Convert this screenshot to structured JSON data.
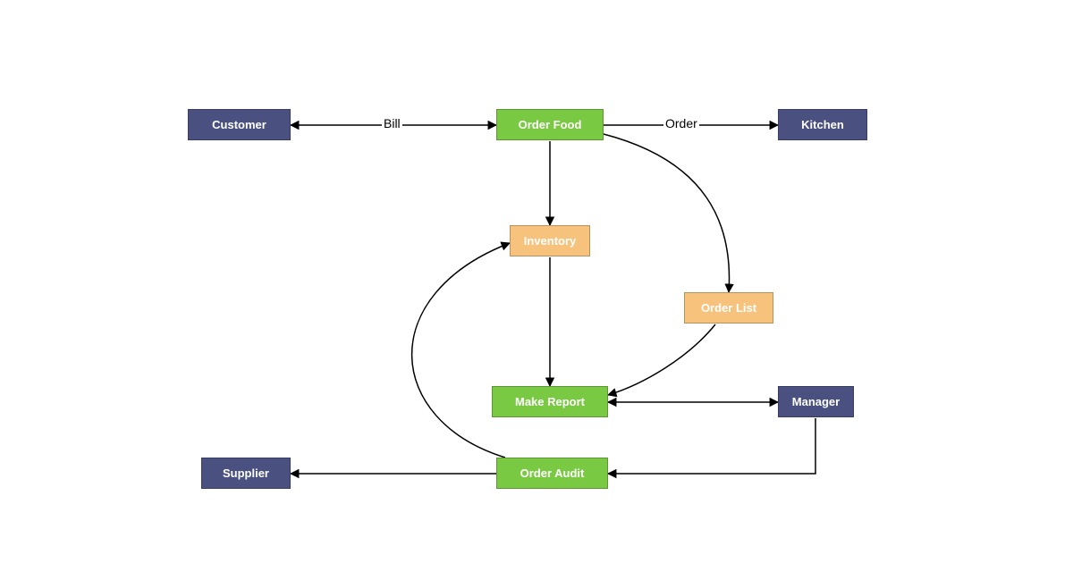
{
  "nodes": {
    "customer": {
      "label": "Customer",
      "type": "entity",
      "color": "purple"
    },
    "orderFood": {
      "label": "Order Food",
      "type": "process",
      "color": "green"
    },
    "kitchen": {
      "label": "Kitchen",
      "type": "entity",
      "color": "purple"
    },
    "inventory": {
      "label": "Inventory",
      "type": "store",
      "color": "orange"
    },
    "orderList": {
      "label": "Order List",
      "type": "store",
      "color": "orange"
    },
    "makeReport": {
      "label": "Make Report",
      "type": "process",
      "color": "green"
    },
    "manager": {
      "label": "Manager",
      "type": "entity",
      "color": "purple"
    },
    "supplier": {
      "label": "Supplier",
      "type": "entity",
      "color": "purple"
    },
    "orderAudit": {
      "label": "Order Audit",
      "type": "process",
      "color": "green"
    }
  },
  "edges": [
    {
      "from": "orderFood",
      "to": "customer",
      "bidirectional": true,
      "label": "Bill"
    },
    {
      "from": "orderFood",
      "to": "kitchen",
      "bidirectional": false,
      "label": "Order"
    },
    {
      "from": "orderFood",
      "to": "inventory",
      "bidirectional": false,
      "label": ""
    },
    {
      "from": "orderFood",
      "to": "orderList",
      "bidirectional": false,
      "label": ""
    },
    {
      "from": "inventory",
      "to": "makeReport",
      "bidirectional": false,
      "label": ""
    },
    {
      "from": "orderList",
      "to": "makeReport",
      "bidirectional": false,
      "label": ""
    },
    {
      "from": "makeReport",
      "to": "manager",
      "bidirectional": true,
      "label": ""
    },
    {
      "from": "manager",
      "to": "orderAudit",
      "bidirectional": false,
      "label": ""
    },
    {
      "from": "orderAudit",
      "to": "supplier",
      "bidirectional": false,
      "label": ""
    },
    {
      "from": "orderAudit",
      "to": "inventory",
      "bidirectional": false,
      "label": ""
    }
  ],
  "edgeLabels": {
    "bill": "Bill",
    "order": "Order"
  },
  "colors": {
    "entity": "#4a5180",
    "process": "#7ac943",
    "store": "#f7c27b",
    "stroke": "#000000"
  }
}
